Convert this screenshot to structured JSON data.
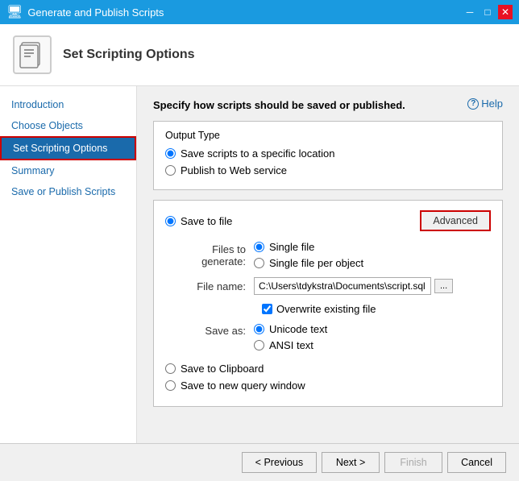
{
  "titleBar": {
    "title": "Generate and Publish Scripts",
    "icon": "📜"
  },
  "header": {
    "title": "Set Scripting Options"
  },
  "helpLink": "Help",
  "sidebar": {
    "items": [
      {
        "id": "introduction",
        "label": "Introduction",
        "state": "link"
      },
      {
        "id": "choose-objects",
        "label": "Choose Objects",
        "state": "link"
      },
      {
        "id": "set-scripting-options",
        "label": "Set Scripting Options",
        "state": "active"
      },
      {
        "id": "summary",
        "label": "Summary",
        "state": "disabled"
      },
      {
        "id": "save-or-publish",
        "label": "Save or Publish Scripts",
        "state": "disabled"
      }
    ]
  },
  "main": {
    "description": "Specify how scripts should be saved or published.",
    "outputType": {
      "label": "Output Type",
      "options": [
        {
          "id": "save-to-location",
          "label": "Save scripts to a specific location",
          "checked": true
        },
        {
          "id": "publish-web",
          "label": "Publish to Web service",
          "checked": false
        }
      ]
    },
    "saveToFile": {
      "radioLabel": "Save to file",
      "checked": true,
      "advancedBtn": "Advanced",
      "filesToGenerate": {
        "label": "Files to generate:",
        "options": [
          {
            "id": "single-file",
            "label": "Single file",
            "checked": true
          },
          {
            "id": "single-file-per-object",
            "label": "Single file per object",
            "checked": false
          }
        ]
      },
      "fileName": {
        "label": "File name:",
        "value": "C:\\Users\\tdykstra\\Documents\\script.sql",
        "browseBtn": "..."
      },
      "overwrite": {
        "label": "Overwrite existing file",
        "checked": true
      },
      "saveAs": {
        "label": "Save as:",
        "options": [
          {
            "id": "unicode",
            "label": "Unicode text",
            "checked": true
          },
          {
            "id": "ansi",
            "label": "ANSI text",
            "checked": false
          }
        ]
      }
    },
    "saveToClipboard": {
      "label": "Save to Clipboard",
      "checked": false
    },
    "saveToQueryWindow": {
      "label": "Save to new query window",
      "checked": false
    }
  },
  "buttons": {
    "previous": "< Previous",
    "next": "Next >",
    "finish": "Finish",
    "cancel": "Cancel"
  }
}
